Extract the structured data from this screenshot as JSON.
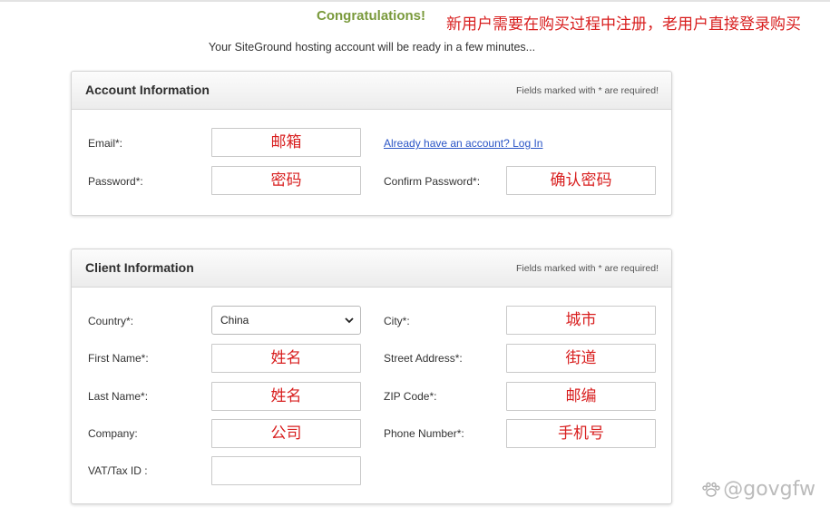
{
  "header": {
    "congrats": "Congratulations!",
    "annotation": "新用户需要在购买过程中注册，老用户直接登录购买",
    "subtitle": "Your SiteGround hosting account will be ready in a few minutes..."
  },
  "account": {
    "title": "Account Information",
    "note": "Fields marked with * are required!",
    "email_label": "Email*:",
    "email_value": "邮箱",
    "login_link": "Already have an account? Log In",
    "password_label": "Password*:",
    "password_value": "密码",
    "confirm_label": "Confirm Password*:",
    "confirm_value": "确认密码"
  },
  "client": {
    "title": "Client Information",
    "note": "Fields marked with * are required!",
    "country_label": "Country*:",
    "country_value": "China",
    "city_label": "City*:",
    "city_value": "城市",
    "first_name_label": "First Name*:",
    "first_name_value": "姓名",
    "street_label": "Street Address*:",
    "street_value": "街道",
    "last_name_label": "Last Name*:",
    "last_name_value": "姓名",
    "zip_label": "ZIP Code*:",
    "zip_value": "邮编",
    "company_label": "Company:",
    "company_value": "公司",
    "phone_label": "Phone Number*:",
    "phone_value": "手机号",
    "vat_label": "VAT/Tax ID :",
    "vat_value": ""
  },
  "watermark": "@govgfw",
  "colors": {
    "accent_green": "#7a9a3c",
    "annotation_red": "#d81e1e",
    "link_blue": "#2a55c6"
  },
  "icons": {
    "select_chevron": "chevron-down-icon",
    "watermark_logo": "paw-icon"
  }
}
